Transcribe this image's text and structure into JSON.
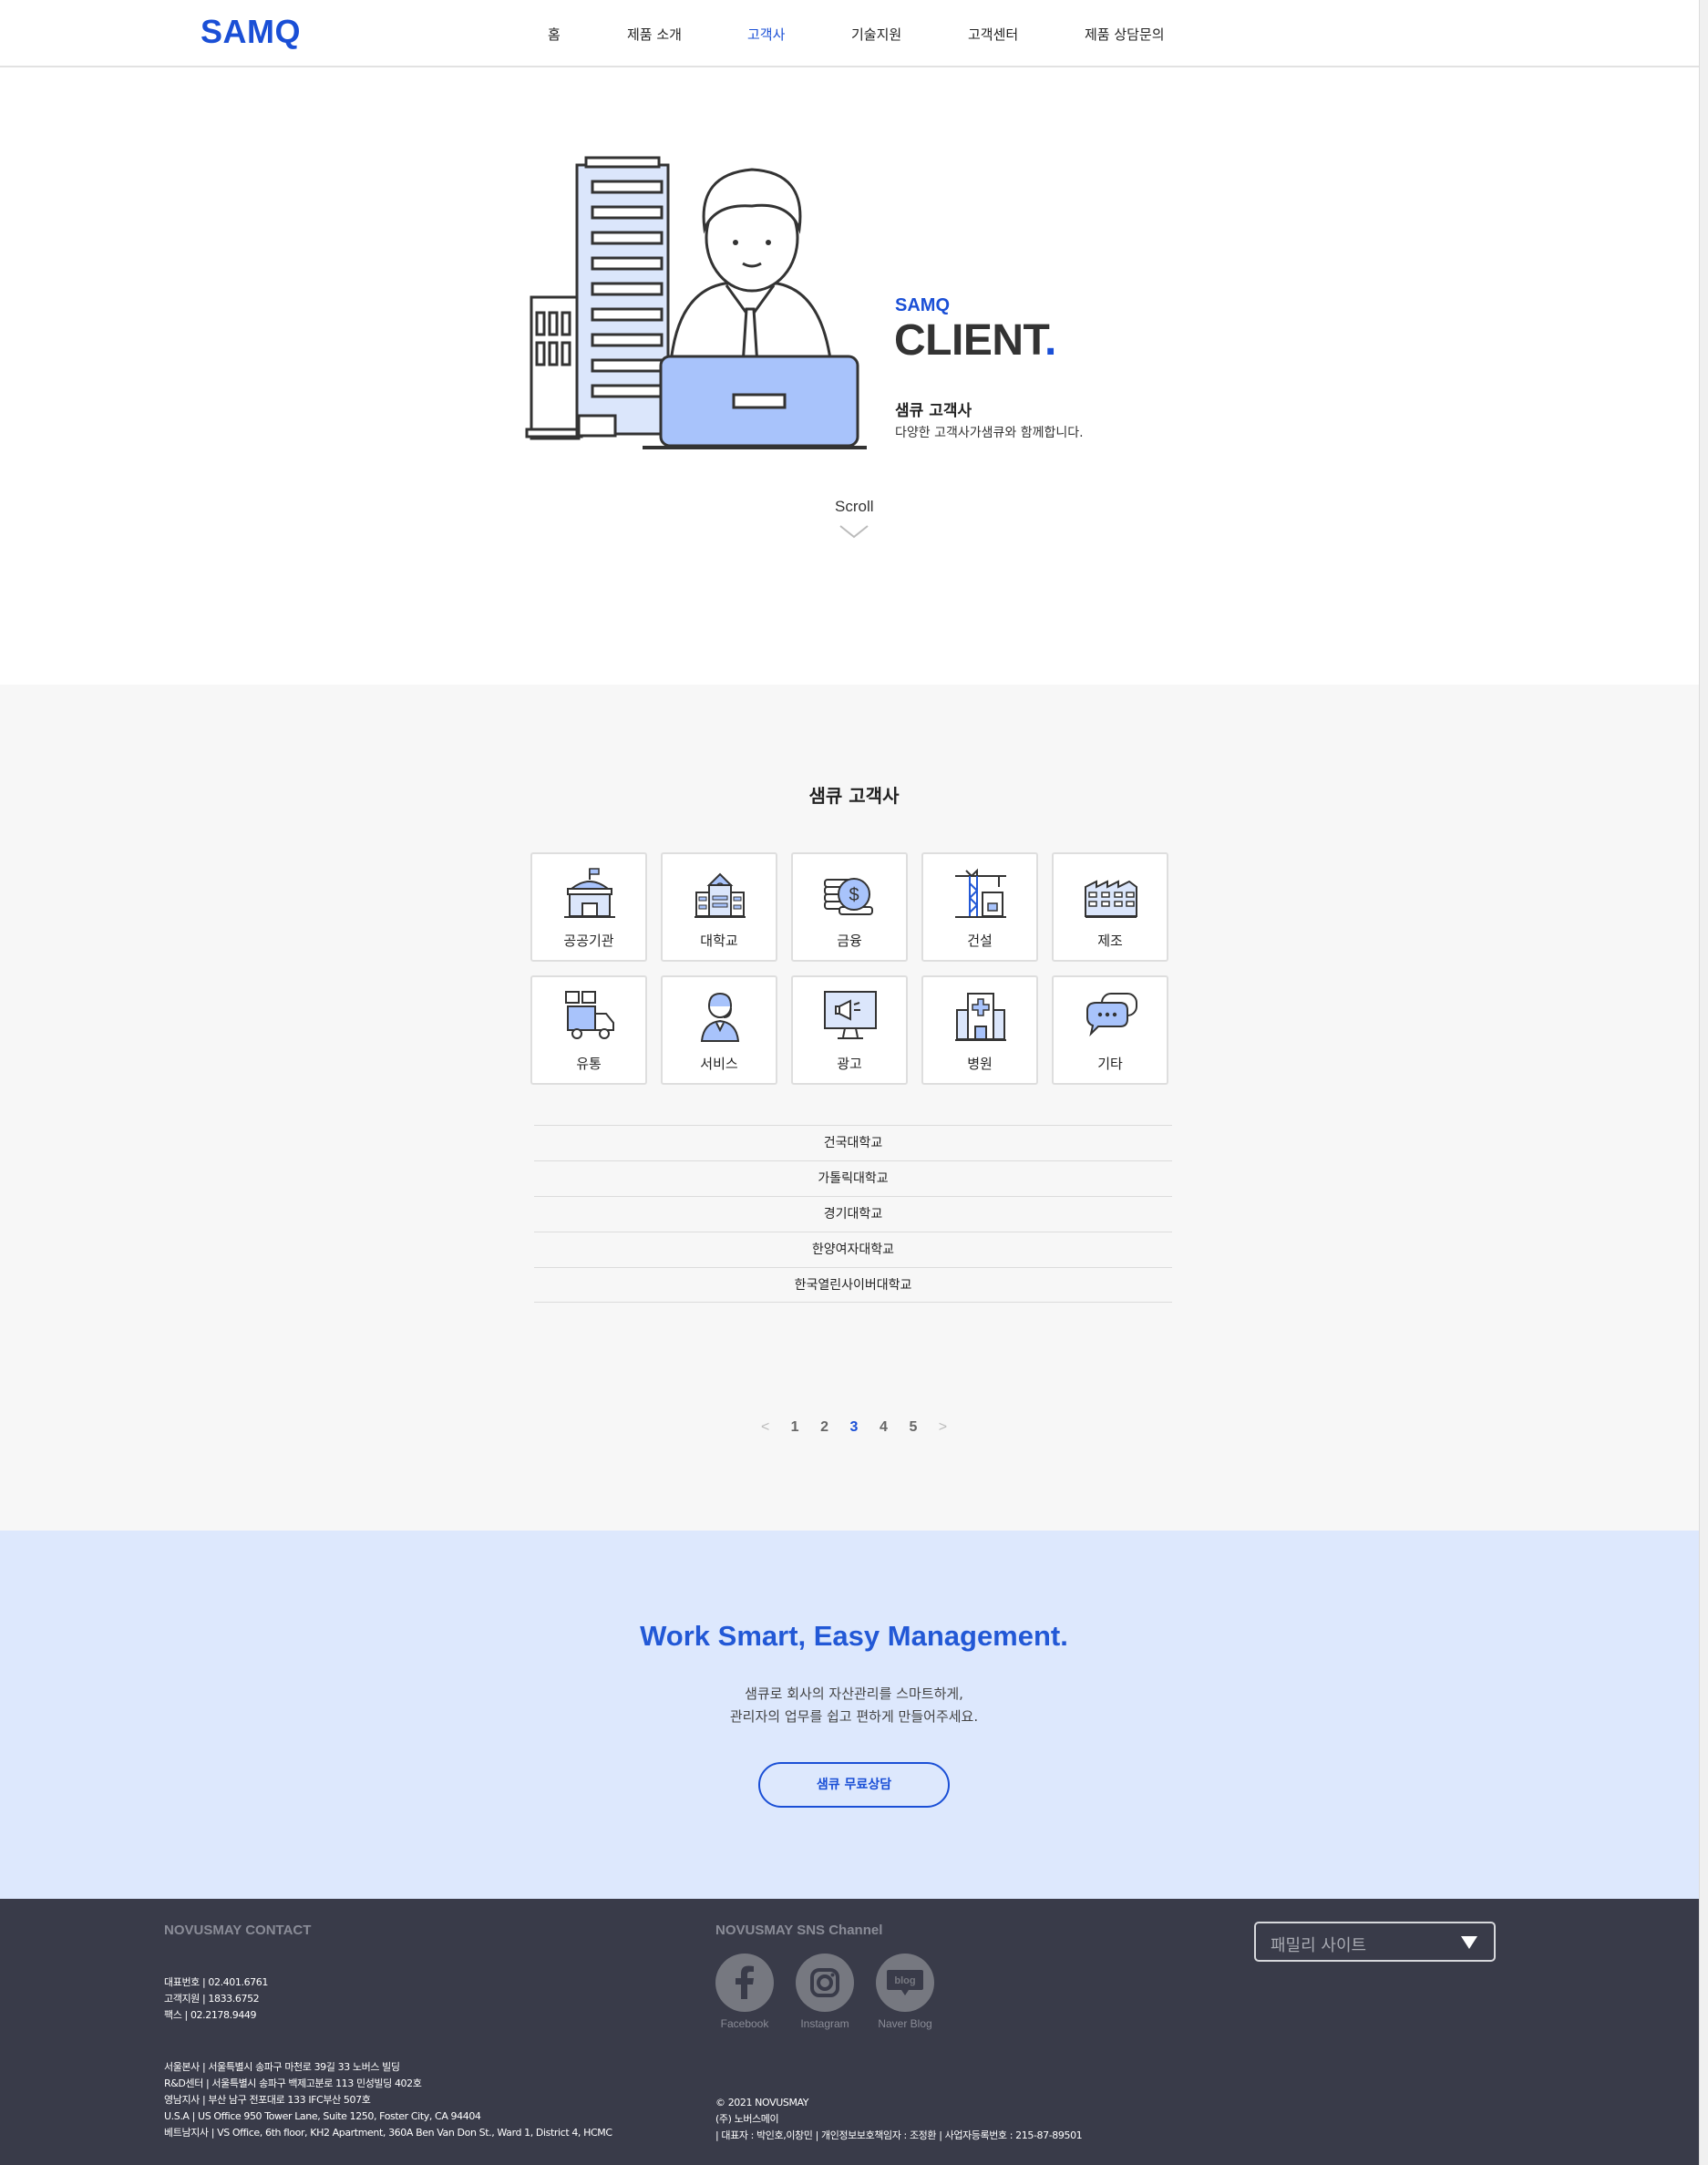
{
  "header": {
    "logo": "SAMQ",
    "nav": [
      "홈",
      "제품 소개",
      "고객사",
      "기술지원",
      "고객센터",
      "제품 상담문의"
    ],
    "active_index": 2
  },
  "hero": {
    "brand": "SAMQ",
    "title": "CLIENT",
    "title_dot": ".",
    "subtitle": "샘큐 고객사",
    "description": "다양한 고객사가샘큐와 함께합니다.",
    "scroll_label": "Scroll"
  },
  "clients": {
    "title": "샘큐 고객사",
    "categories": [
      {
        "label": "공공기관",
        "icon": "government-building-icon"
      },
      {
        "label": "대학교",
        "icon": "university-icon"
      },
      {
        "label": "금융",
        "icon": "finance-coins-icon"
      },
      {
        "label": "건설",
        "icon": "construction-crane-icon"
      },
      {
        "label": "제조",
        "icon": "factory-icon"
      },
      {
        "label": "유통",
        "icon": "delivery-truck-icon"
      },
      {
        "label": "서비스",
        "icon": "service-agent-icon"
      },
      {
        "label": "광고",
        "icon": "advertising-monitor-icon"
      },
      {
        "label": "병원",
        "icon": "hospital-icon"
      },
      {
        "label": "기타",
        "icon": "chat-bubble-icon"
      }
    ],
    "list": [
      "건국대학교",
      "가톨릭대학교",
      "경기대학교",
      "한양여자대학교",
      "한국열린사이버대학교"
    ],
    "pagination": {
      "prev": "<",
      "pages": [
        "1",
        "2",
        "3",
        "4",
        "5"
      ],
      "current": "3",
      "next": ">"
    }
  },
  "cta": {
    "title": "Work Smart, Easy Management.",
    "line1": "샘큐로 회사의 자산관리를 스마트하게,",
    "line2": "관리자의 업무를 쉽고 편하게 만들어주세요.",
    "button": "샘큐 무료상담"
  },
  "footer": {
    "contact_title": "NOVUSMAY CONTACT",
    "contacts": [
      "대표번호  |   02.401.6761",
      "고객지원  |   1833.6752",
      "팩스  |   02.2178.9449"
    ],
    "offices": [
      "서울본사  |   서울특별시 송파구 마천로 39길 33 노버스 빌딩",
      "R&D센터  |   서울특별시 송파구 백제고분로 113 민성빌딩 402호",
      "영남지사  |   부산 남구 전포대로 133 IFC부산 507호",
      "U.S.A  |   US Office 950 Tower Lane, Suite 1250, Foster City, CA 94404",
      "베트남지사  |   VS Office, 6th floor, KH2 Apartment, 360A Ben Van Don St., Ward 1, District 4, HCMC"
    ],
    "sns_title": "NOVUSMAY SNS Channel",
    "sns": [
      {
        "label": "Facebook",
        "icon": "facebook-icon"
      },
      {
        "label": "Instagram",
        "icon": "instagram-icon"
      },
      {
        "label": "Naver Blog",
        "icon": "naver-blog-icon"
      }
    ],
    "copyright": "© 2021 NOVUSMAY",
    "company": "(주) 노버스메이",
    "legal": "|  대표자 : 박인호,이창민   |  개인정보보호책임자 : 조정환   |  사업자등록번호 : 215-87-89501",
    "family_site": "패밀리 사이트"
  }
}
